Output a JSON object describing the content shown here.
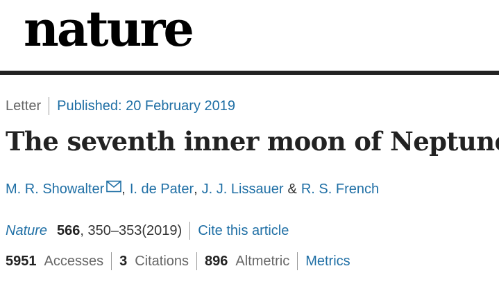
{
  "masthead": {
    "logo_text": "nature"
  },
  "article": {
    "type": "Letter",
    "published": "Published: 20 February 2019",
    "title": "The seventh inner moon of Neptune"
  },
  "authors": {
    "list": [
      "M. R. Showalter",
      "I. de Pater",
      "J. J. Lissauer",
      "R. S. French"
    ],
    "separator": ",",
    "ampersand": "&",
    "contact_icon": "envelope-icon"
  },
  "citation": {
    "journal": "Nature",
    "volume": "566",
    "pages": ", 350–353",
    "year": "(2019)",
    "cite_link": "Cite this article"
  },
  "metrics": {
    "accesses_count": "5951",
    "accesses_label": "Accesses",
    "citations_count": "3",
    "citations_label": "Citations",
    "altmetric_count": "896",
    "altmetric_label": "Altmetric",
    "metrics_link": "Metrics"
  },
  "colors": {
    "link": "#1f6fa5",
    "rule": "#222222",
    "logo": "#000000"
  }
}
